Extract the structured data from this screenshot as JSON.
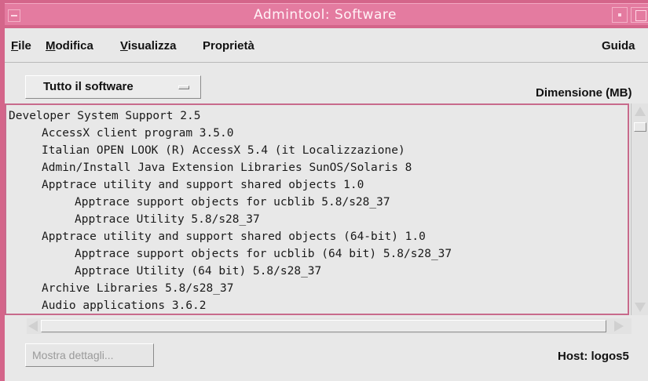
{
  "window": {
    "title": "Admintool: Software",
    "colors": {
      "titlebar": "#e47ba0",
      "frame": "#d4658a",
      "surface": "#e8e8e8"
    }
  },
  "menubar": {
    "file": {
      "mnemonic": "F",
      "rest": "ile"
    },
    "edit": {
      "mnemonic": "M",
      "rest": "odifica"
    },
    "view": {
      "mnemonic": "V",
      "rest": "isualizza"
    },
    "properties": "Proprietà",
    "help": "Guida"
  },
  "filter": {
    "selected": "Tutto il software"
  },
  "list": {
    "column_header": "Dimensione (MB)",
    "items": [
      {
        "indent": 0,
        "text": "Developer System Support 2.5"
      },
      {
        "indent": 1,
        "text": "AccessX client program 3.5.0"
      },
      {
        "indent": 1,
        "text": "Italian OPEN LOOK (R) AccessX 5.4 (it Localizzazione)"
      },
      {
        "indent": 1,
        "text": "Admin/Install Java Extension Libraries SunOS/Solaris 8"
      },
      {
        "indent": 1,
        "text": "Apptrace utility and support shared objects 1.0"
      },
      {
        "indent": 2,
        "text": "Apptrace support objects for ucblib 5.8/s28_37"
      },
      {
        "indent": 2,
        "text": "Apptrace Utility 5.8/s28_37"
      },
      {
        "indent": 1,
        "text": "Apptrace utility and support shared objects (64-bit) 1.0"
      },
      {
        "indent": 2,
        "text": "Apptrace support objects for ucblib (64 bit) 5.8/s28_37"
      },
      {
        "indent": 2,
        "text": "Apptrace Utility (64 bit) 5.8/s28_37"
      },
      {
        "indent": 1,
        "text": "Archive Libraries 5.8/s28_37"
      },
      {
        "indent": 1,
        "text": "Audio applications 3.6.2"
      }
    ]
  },
  "footer": {
    "details_button": "Mostra dettagli...",
    "host": "Host: logos5"
  }
}
